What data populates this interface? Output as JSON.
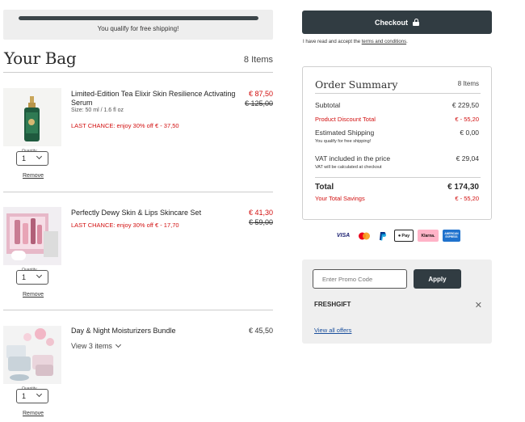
{
  "shipping": {
    "progress": 1.0,
    "message": "You qualify for free shipping!"
  },
  "bag": {
    "title": "Your Bag",
    "count": "8 Items",
    "quantity_label": "Quantity",
    "remove_label": "Remove",
    "items": [
      {
        "name": "Limited-Edition Tea Elixir Skin Resilience Activating Serum",
        "size": "Size: 50 ml / 1.6 fl oz",
        "promo": "LAST CHANCE: enjoy 30% off € - 37,50",
        "price": "€ 87,50",
        "original_price": "€ 125,00",
        "quantity": "1"
      },
      {
        "name": "Perfectly Dewy Skin & Lips Skincare Set",
        "promo": "LAST CHANCE: enjoy 30% off € - 17,70",
        "price": "€ 41,30",
        "original_price": "€ 59,00",
        "quantity": "1"
      },
      {
        "name": "Day & Night Moisturizers Bundle",
        "price": "€ 45,50",
        "view_items": "View 3 items",
        "quantity": "1"
      }
    ]
  },
  "checkout": {
    "label": "Checkout",
    "terms_prefix": "I have read and accept the ",
    "terms_link": "terms and conditions",
    "terms_suffix": "."
  },
  "summary": {
    "title": "Order Summary",
    "count": "8 Items",
    "subtotal_label": "Subtotal",
    "subtotal_value": "€ 229,50",
    "discount_label": "Product Discount Total",
    "discount_value": "€ - 55,20",
    "shipping_label": "Estimated Shipping",
    "shipping_value": "€ 0,00",
    "shipping_note": "You qualify for free shipping!",
    "vat_label": "VAT included in the price",
    "vat_value": "€ 29,04",
    "vat_note": "VAT will be calculated at checkout",
    "total_label": "Total",
    "total_value": "€ 174,30",
    "savings_label": "Your Total Savings",
    "savings_value": "€ - 55,20"
  },
  "payment_methods": [
    "VISA",
    "Mastercard",
    "PayPal",
    "Pay",
    "Klarna.",
    "AMERICAN EXPRESS"
  ],
  "promo": {
    "placeholder": "Enter Promo Code",
    "apply_label": "Apply",
    "applied_code": "FRESHGIFT",
    "remove_symbol": "✕",
    "view_all": "View all offers"
  },
  "colors": {
    "accent_dark": "#313c42",
    "sale_red": "#d21010",
    "link_blue": "#1a4f9c"
  }
}
